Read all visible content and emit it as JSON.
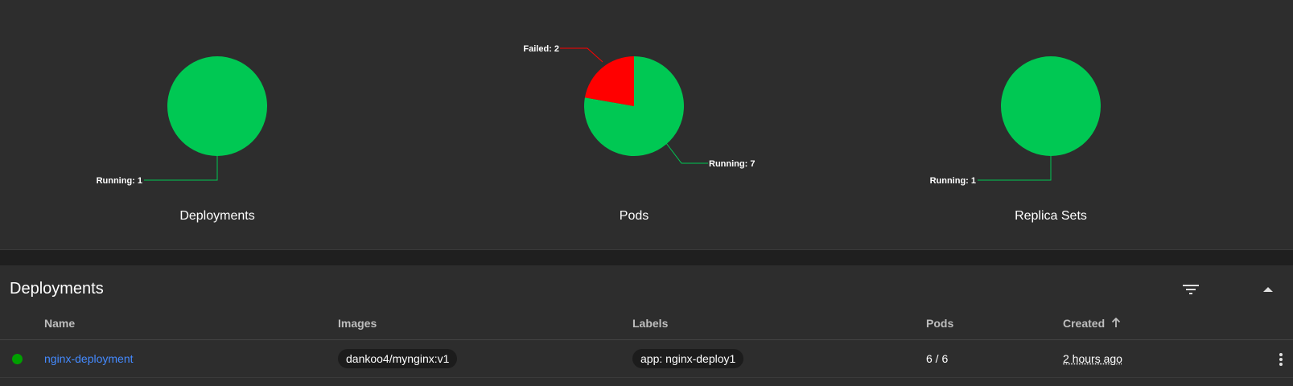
{
  "charts": [
    {
      "title": "Deployments",
      "slices": [
        {
          "label": "Running: 1",
          "value": 1,
          "color": "#00c853"
        }
      ]
    },
    {
      "title": "Pods",
      "slices": [
        {
          "label": "Running: 7",
          "value": 7,
          "color": "#00c853"
        },
        {
          "label": "Failed: 2",
          "value": 2,
          "color": "#ff0000"
        }
      ]
    },
    {
      "title": "Replica Sets",
      "slices": [
        {
          "label": "Running: 1",
          "value": 1,
          "color": "#00c853"
        }
      ]
    }
  ],
  "chart_data": [
    {
      "type": "pie",
      "title": "Deployments",
      "categories": [
        "Running"
      ],
      "values": [
        1
      ]
    },
    {
      "type": "pie",
      "title": "Pods",
      "categories": [
        "Running",
        "Failed"
      ],
      "values": [
        7,
        2
      ]
    },
    {
      "type": "pie",
      "title": "Replica Sets",
      "categories": [
        "Running"
      ],
      "values": [
        1
      ]
    }
  ],
  "deployments": {
    "title": "Deployments",
    "filter_icon": "filter-list-icon",
    "collapse_icon": "arrow-drop-up-icon",
    "columns": {
      "name": "Name",
      "images": "Images",
      "labels": "Labels",
      "pods": "Pods",
      "created": "Created"
    },
    "sort_icon": "arrow-upward-icon",
    "rows": [
      {
        "status": "running",
        "status_color": "#00a000",
        "name": "nginx-deployment",
        "image": "dankoo4/mynginx:v1",
        "label": "app: nginx-deploy1",
        "pods": "6 / 6",
        "created": "2 hours ago",
        "menu_icon": "more-vert-icon"
      }
    ]
  }
}
